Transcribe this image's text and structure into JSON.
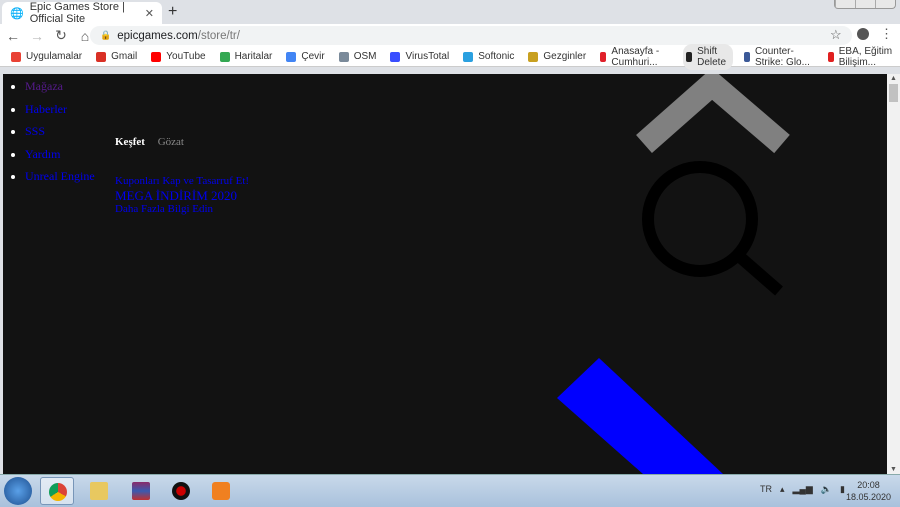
{
  "browser": {
    "tab_title": "Epic Games Store | Official Site",
    "url_host": "epicgames.com",
    "url_path": "/store/tr/",
    "bookmarks": [
      {
        "label": "Uygulamalar",
        "color": "#e94235"
      },
      {
        "label": "Gmail",
        "color": "#d93025"
      },
      {
        "label": "YouTube",
        "color": "#ff0000"
      },
      {
        "label": "Haritalar",
        "color": "#34a853"
      },
      {
        "label": "Çevir",
        "color": "#4285f4"
      },
      {
        "label": "OSM",
        "color": "#7a8a9a"
      },
      {
        "label": "VirusTotal",
        "color": "#394eff"
      },
      {
        "label": "Softonic",
        "color": "#2aa0e0"
      },
      {
        "label": "Gezginler",
        "color": "#c8a020"
      },
      {
        "label": "Anasayfa - Cumhuri...",
        "color": "#e0202a"
      },
      {
        "label": "Shift Delete",
        "color": "#222222"
      },
      {
        "label": "Counter-Strike: Glo...",
        "color": "#3b5998"
      },
      {
        "label": "EBA, Eğitim Bilişim...",
        "color": "#e02020"
      }
    ]
  },
  "page": {
    "nav": [
      "Mağaza",
      "Haberler",
      "SSS",
      "Yardım",
      "Unreal Engine"
    ],
    "tabs": {
      "active": "Keşfet",
      "inactive": "Gözat"
    },
    "promo": {
      "line1": "Kuponları Kap ve Tasarruf Et!",
      "title": "MEGA İNDİRİM 2020",
      "link": "Daha Fazla Bilgi Edin"
    },
    "colors": {
      "background": "#121212",
      "link": "#0000ee",
      "visited": "#551a8b",
      "chevron": "#808080",
      "blue_bar": "#0000ff"
    }
  },
  "taskbar": {
    "lang": "TR",
    "time": "20:08",
    "date": "18.05.2020"
  }
}
